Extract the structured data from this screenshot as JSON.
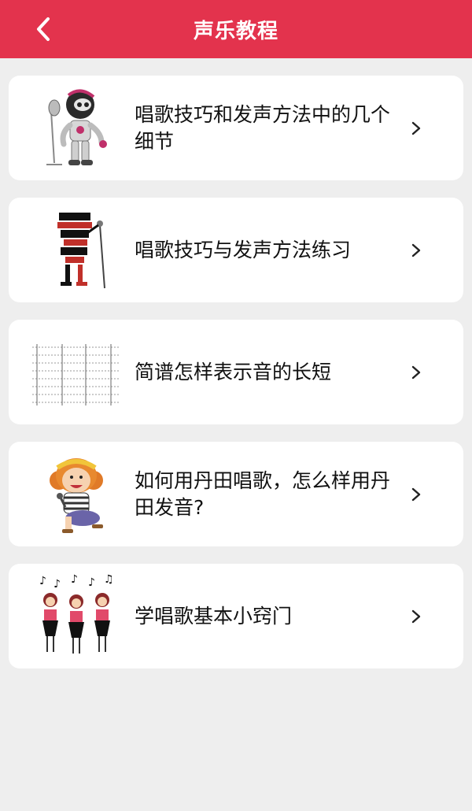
{
  "header": {
    "title": "声乐教程",
    "back_icon": "chevron-left-icon",
    "background_color": "#e3334d"
  },
  "items": [
    {
      "title": "唱歌技巧和发声方法中的几个细节",
      "thumbnail": "robot-singer-illustration"
    },
    {
      "title": "唱歌技巧与发声方法练习",
      "thumbnail": "typography-singer-illustration"
    },
    {
      "title": "简谱怎样表示音的长短",
      "thumbnail": "sheet-music-image"
    },
    {
      "title": "如何用丹田唱歌，怎么样用丹田发音?",
      "thumbnail": "cartoon-girl-singer-illustration"
    },
    {
      "title": "学唱歌基本小窍门",
      "thumbnail": "choir-girls-illustration"
    }
  ],
  "chevron_icon": "chevron-right-icon"
}
